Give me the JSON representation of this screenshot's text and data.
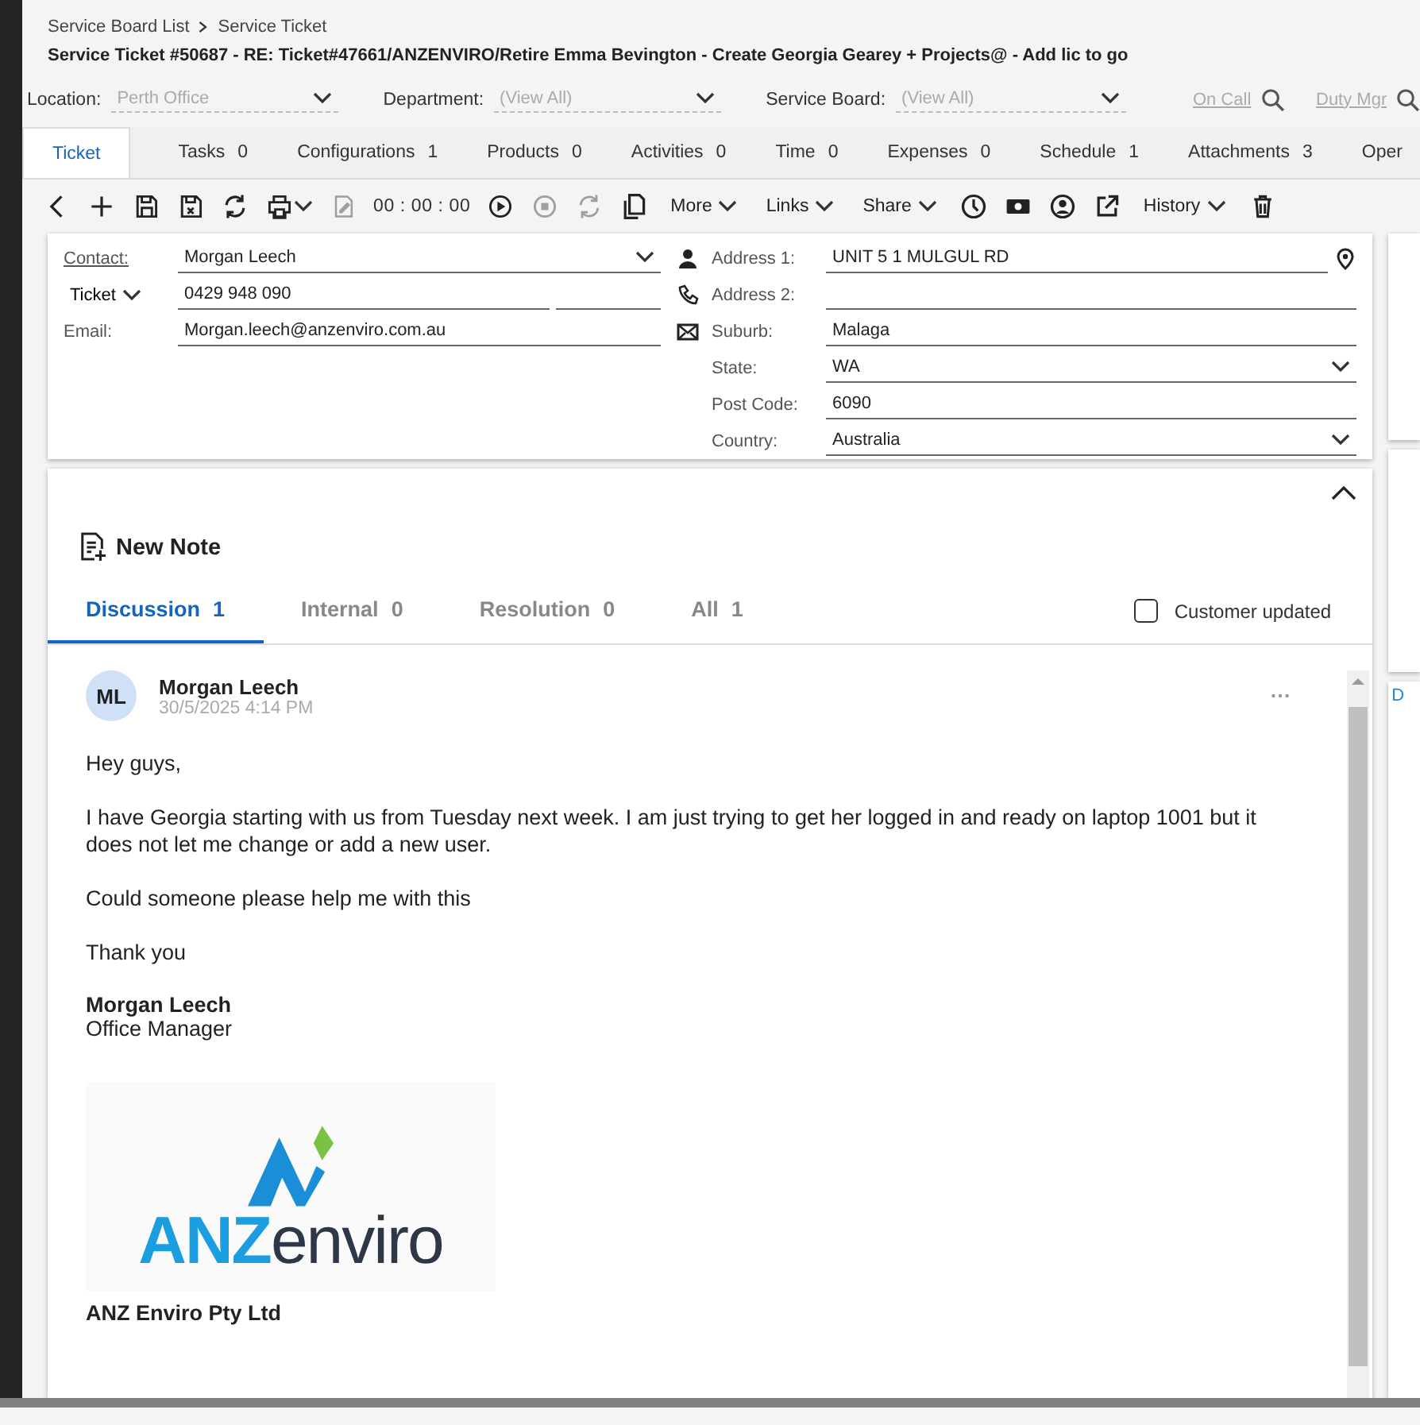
{
  "breadcrumb": [
    "Service Board List",
    "Service Ticket"
  ],
  "title": "Service Ticket #50687 - RE: Ticket#47661/ANZENVIRO/Retire Emma Bevington - Create Georgia Gearey + Projects@ - Add lic to go",
  "filters": [
    {
      "kind": "select",
      "label": "Location:",
      "value": "Perth Office"
    },
    {
      "kind": "select",
      "label": "Department:",
      "value": "(View All)"
    },
    {
      "kind": "select",
      "label": "Service Board:",
      "value": "(View All)"
    },
    {
      "kind": "link",
      "label": "On Call"
    },
    {
      "kind": "link",
      "label": "Duty Mgr"
    }
  ],
  "tabs": [
    {
      "label": "Ticket",
      "selected": true
    },
    {
      "label": "Tasks",
      "count": "0",
      "selected": false
    },
    {
      "label": "Configurations",
      "count": "1",
      "selected": false
    },
    {
      "label": "Products",
      "count": "0",
      "selected": false
    },
    {
      "label": "Activities",
      "count": "0",
      "selected": false
    },
    {
      "label": "Time",
      "count": "0",
      "selected": false
    },
    {
      "label": "Expenses",
      "count": "0",
      "selected": false
    },
    {
      "label": "Schedule",
      "count": "1",
      "selected": false
    },
    {
      "label": "Attachments",
      "count": "3",
      "selected": false
    },
    {
      "label": "Oper",
      "selected": false
    }
  ],
  "toolbar": [
    {
      "kind": "button",
      "disabled": false
    },
    {
      "kind": "button",
      "disabled": false
    },
    {
      "kind": "button",
      "disabled": false
    },
    {
      "kind": "button",
      "disabled": false
    },
    {
      "kind": "button",
      "disabled": false
    },
    {
      "kind": "button",
      "disabled": false
    },
    {
      "kind": "button",
      "disabled": true
    },
    {
      "kind": "timer",
      "label": "00 : 00 : 00"
    },
    {
      "kind": "button",
      "disabled": false
    },
    {
      "kind": "button",
      "disabled": true
    },
    {
      "kind": "button",
      "disabled": true
    },
    {
      "kind": "button",
      "disabled": false
    },
    {
      "kind": "menu",
      "label": "More"
    },
    {
      "kind": "menu",
      "label": "Links"
    },
    {
      "kind": "menu",
      "label": "Share"
    },
    {
      "kind": "button",
      "disabled": false
    },
    {
      "kind": "button",
      "disabled": false
    },
    {
      "kind": "button",
      "disabled": false
    },
    {
      "kind": "button",
      "disabled": false
    },
    {
      "kind": "menu",
      "label": "History"
    },
    {
      "kind": "button",
      "disabled": false
    }
  ],
  "contact": {
    "contact_label": "Contact:",
    "contact_value": "Morgan Leech",
    "phone_type": "Ticket",
    "phone": "0429 948 090",
    "email_label": "Email:",
    "email": "Morgan.leech@anzenviro.com.au"
  },
  "address": [
    {
      "label": "Address 1:",
      "value": "UNIT 5 1 MULGUL RD",
      "kind": "location"
    },
    {
      "label": "Address 2:",
      "kind": "text"
    },
    {
      "label": "Suburb:",
      "value": "Malaga",
      "kind": "text"
    },
    {
      "label": "State:",
      "value": "WA",
      "kind": "select"
    },
    {
      "label": "Post Code:",
      "value": "6090",
      "kind": "text"
    },
    {
      "label": "Country:",
      "value": "Australia",
      "kind": "select"
    }
  ],
  "notes": {
    "new_note": "New Note",
    "tabs": [
      {
        "label": "Discussion",
        "count": "1",
        "selected": true
      },
      {
        "label": "Internal",
        "count": "0",
        "selected": false
      },
      {
        "label": "Resolution",
        "count": "0",
        "selected": false
      },
      {
        "label": "All",
        "count": "1",
        "selected": false
      }
    ],
    "customer_updated": {
      "label": "Customer updated",
      "checked": false
    },
    "note": {
      "initials": "ML",
      "author": "Morgan Leech",
      "date": "30/5/2025 4:14 PM",
      "body": [
        "Hey guys,",
        "I have Georgia starting with us from Tuesday next week. I am just trying to get her logged in and ready on laptop 1001 but it does not let me change or add a new user.",
        "Could someone please help me with this",
        "Thank you"
      ],
      "signature_name": "Morgan Leech",
      "signature_title": "Office Manager",
      "logo": {
        "part_1": "ANZ",
        "part_2": "enviro"
      },
      "company": "ANZ Enviro Pty Ltd"
    }
  },
  "side_panel_label": "D"
}
